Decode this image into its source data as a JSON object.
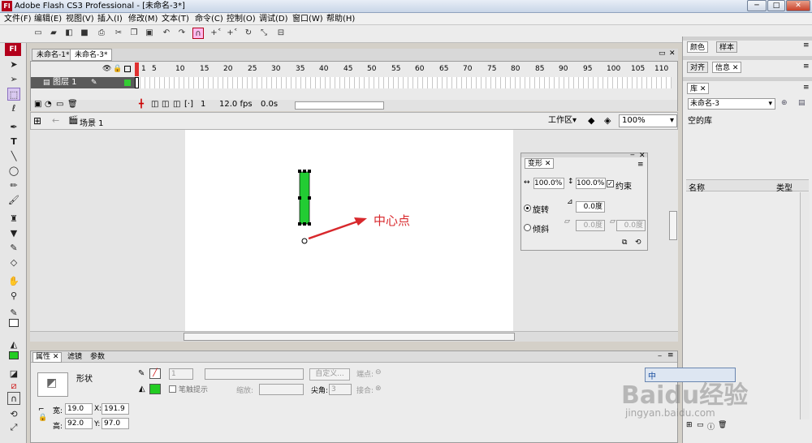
{
  "window": {
    "title": "Adobe Flash CS3 Professional - [未命名-3*]",
    "logo": "Fl"
  },
  "menu": [
    "文件(F)",
    "编辑(E)",
    "视图(V)",
    "插入(I)",
    "修改(M)",
    "文本(T)",
    "命令(C)",
    "控制(O)",
    "调试(D)",
    "窗口(W)",
    "帮助(H)"
  ],
  "toolbox": {
    "logo": "Fl"
  },
  "docs": {
    "tabs": [
      "未命名-1*",
      "未命名-3*"
    ]
  },
  "timeline": {
    "ruler": [
      "1",
      "5",
      "10",
      "15",
      "20",
      "25",
      "30",
      "35",
      "40",
      "45",
      "50",
      "55",
      "60",
      "65",
      "70",
      "75",
      "80",
      "85",
      "90",
      "95",
      "100",
      "105",
      "110"
    ],
    "layer": "图层 1",
    "frame": "1",
    "fps": "12.0 fps",
    "time": "0.0s"
  },
  "editbar": {
    "scene": "场景 1",
    "workspace": "工作区",
    "zoom": "100%"
  },
  "stage": {
    "annotation": "中心点",
    "annotation_color": "#d8282c",
    "shape_color": "#22cc33"
  },
  "transform_panel": {
    "title": "变形",
    "width_pct": "100.0%",
    "height_pct": "100.0%",
    "constrain": "约束",
    "rotate": "旋转",
    "rotate_val": "0.0度",
    "skew": "倾斜",
    "skew_h": "0.0度",
    "skew_v": "0.0度"
  },
  "properties": {
    "tabs": [
      "属性",
      "滤镜",
      "参数"
    ],
    "type": "形状",
    "stroke_height": "1",
    "custom_btn": "自定义...",
    "endpoint": "端点:",
    "stroke_hint": "笔触提示",
    "scale": "缩放:",
    "miter": "尖角:",
    "miter_val": "3",
    "join": "接合:",
    "w_label": "宽:",
    "w": "19.0",
    "h_label": "高:",
    "h": "92.0",
    "x_label": "X:",
    "x": "191.9",
    "y_label": "Y:",
    "y": "97.0"
  },
  "right_panel": {
    "tabs1": [
      "颜色",
      "样本"
    ],
    "tabs2": [
      "对齐",
      "信息"
    ],
    "library": "库",
    "doc": "未命名-3",
    "empty": "空的库",
    "col_name": "名称",
    "col_type": "类型"
  },
  "watermark": {
    "text": "Baidu经验",
    "sub": "jingyan.baidu.com",
    "popup": "中"
  }
}
